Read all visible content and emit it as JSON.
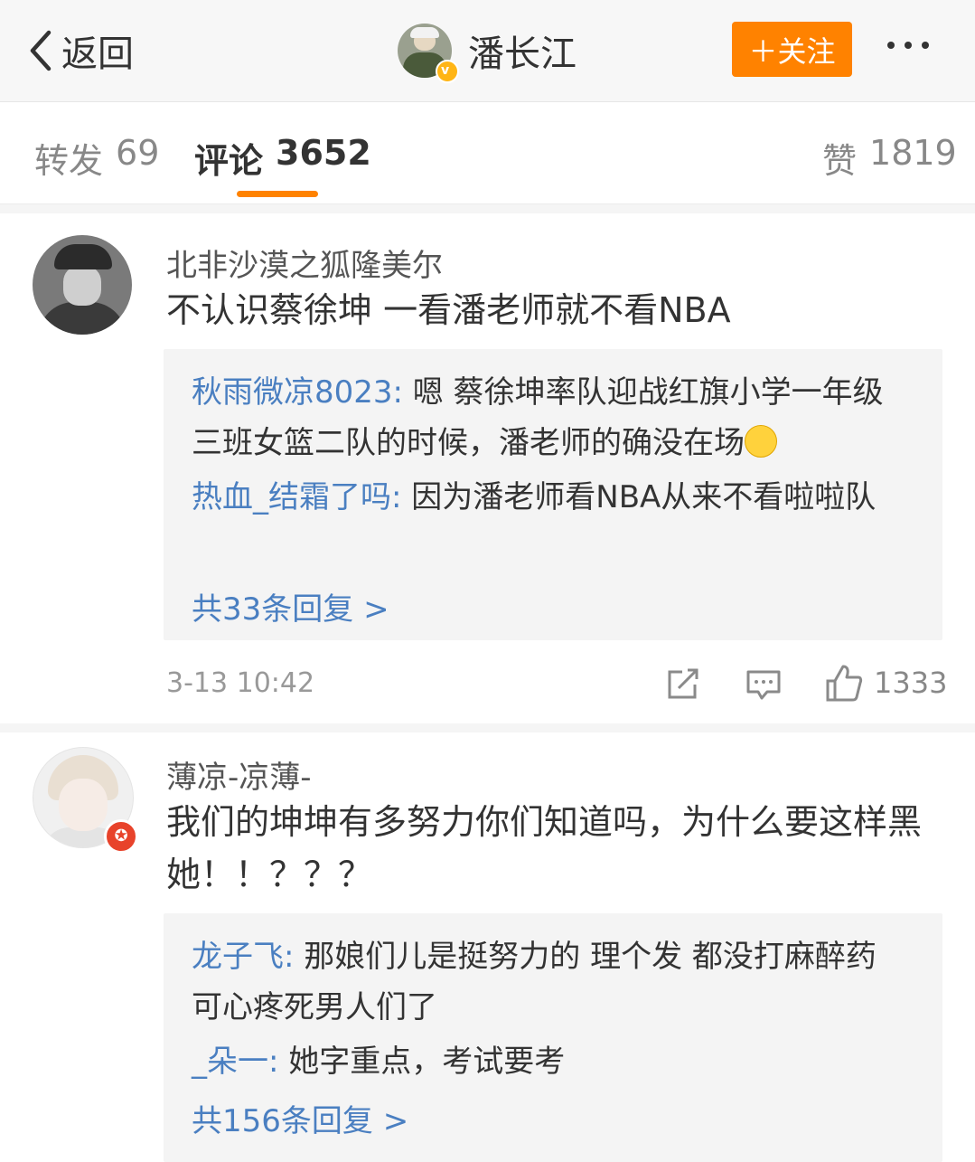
{
  "header": {
    "back_label": "返回",
    "title": "潘长江",
    "follow_label": "＋关注"
  },
  "tabs": {
    "repost": {
      "label": "转发",
      "count": "69"
    },
    "comment": {
      "label": "评论",
      "count": "3652"
    },
    "like": {
      "label": "赞",
      "count": "1819"
    }
  },
  "comments": [
    {
      "username": "北非沙漠之狐隆美尔",
      "text": "不认识蔡徐坤 一看潘老师就不看NBA",
      "replies": [
        {
          "name": "秋雨微凉8023:",
          "text": " 嗯 蔡徐坤率队迎战红旗小学一年级三班女篮二队的时候，潘老师的确没在场"
        },
        {
          "name": "热血_结霜了吗:",
          "text": " 因为潘老师看NBA从来不看啦啦队"
        }
      ],
      "more_replies": "共33条回复 >",
      "time": "3-13 10:42",
      "likes": "1333"
    },
    {
      "username": "薄凉-凉薄-",
      "text": "我们的坤坤有多努力你们知道吗，为什么要这样黑她！！？？？",
      "replies": [
        {
          "name": "龙子飞:",
          "text": " 那娘们儿是挺努力的 理个发 都没打麻醉药  可心疼死男人们了"
        },
        {
          "name": "_朵一:",
          "text": " 她字重点，考试要考"
        }
      ],
      "more_replies": "共156条回复 >"
    }
  ]
}
